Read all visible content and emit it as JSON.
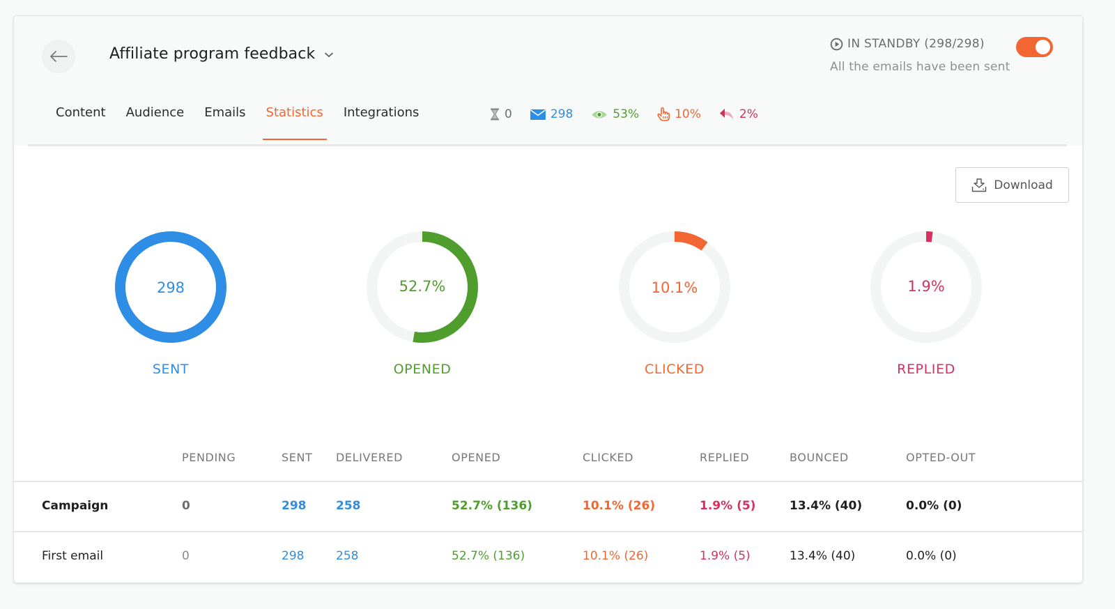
{
  "header": {
    "title": "Affiliate program feedback",
    "status": {
      "label": "IN STANDBY (298/298)",
      "sub": "All the emails have been sent",
      "toggle_on": true
    }
  },
  "tabs": [
    {
      "label": "Content",
      "active": false
    },
    {
      "label": "Audience",
      "active": false
    },
    {
      "label": "Emails",
      "active": false
    },
    {
      "label": "Statistics",
      "active": true
    },
    {
      "label": "Integrations",
      "active": false
    }
  ],
  "kpis": [
    {
      "icon": "hourglass-icon",
      "value": "0",
      "color": "#6d6d6d"
    },
    {
      "icon": "envelope-icon",
      "value": "298",
      "color": "#2e8de4"
    },
    {
      "icon": "eye-icon",
      "value": "53%",
      "color": "#4f9e2d"
    },
    {
      "icon": "pointer-hand-icon",
      "value": "10%",
      "color": "#f26633"
    },
    {
      "icon": "reply-icon",
      "value": "2%",
      "color": "#d6305f"
    }
  ],
  "actions": {
    "download_label": "Download"
  },
  "donuts": [
    {
      "label": "SENT",
      "center": "298",
      "fraction": 1.0,
      "color": "#2e8de4"
    },
    {
      "label": "OPENED",
      "center": "52.7%",
      "fraction": 0.527,
      "color": "#4f9e2d"
    },
    {
      "label": "CLICKED",
      "center": "10.1%",
      "fraction": 0.101,
      "color": "#f26633"
    },
    {
      "label": "REPLIED",
      "center": "1.9%",
      "fraction": 0.019,
      "color": "#d6305f"
    }
  ],
  "colors": {
    "accent": "#f26633",
    "sent": "#2e8de4",
    "opened": "#4f9e2d",
    "clicked": "#f26633",
    "replied": "#d6305f",
    "track": "#f3f4f4"
  },
  "table": {
    "columns": [
      "PENDING",
      "SENT",
      "DELIVERED",
      "OPENED",
      "CLICKED",
      "REPLIED",
      "BOUNCED",
      "OPTED-OUT"
    ],
    "rows": [
      {
        "label": "Campaign",
        "cells": [
          "0",
          "298",
          "258",
          "52.7% (136)",
          "10.1% (26)",
          "1.9% (5)",
          "13.4% (40)",
          "0.0% (0)"
        ]
      },
      {
        "label": "First email",
        "cells": [
          "0",
          "298",
          "258",
          "52.7% (136)",
          "10.1% (26)",
          "1.9% (5)",
          "13.4% (40)",
          "0.0% (0)"
        ]
      }
    ]
  }
}
